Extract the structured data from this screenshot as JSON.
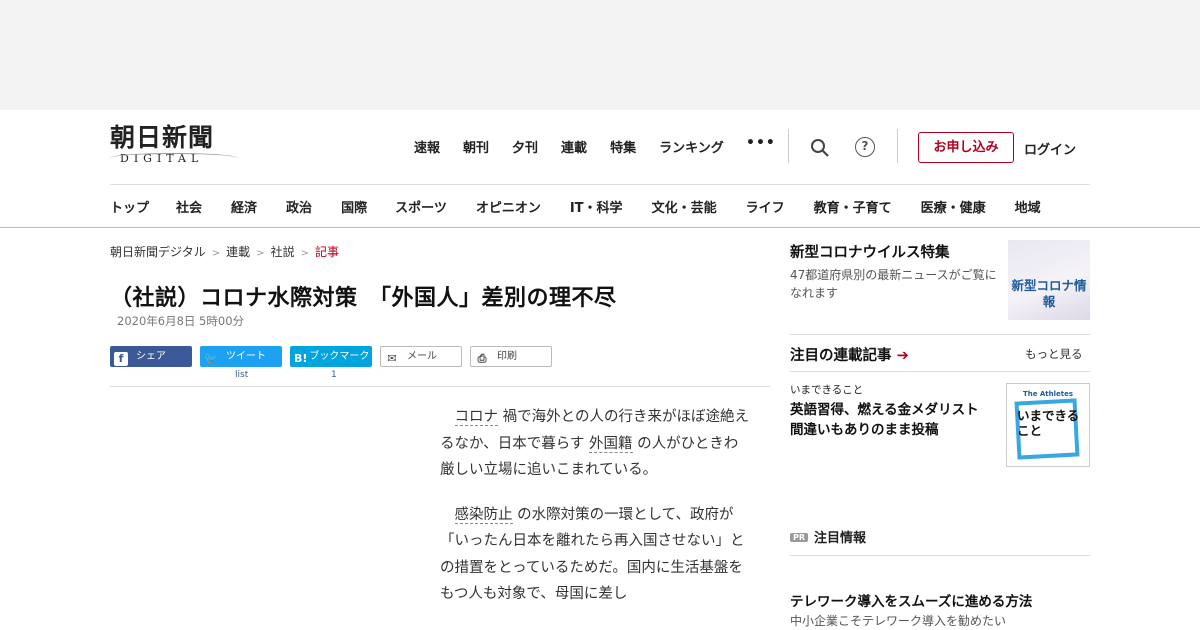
{
  "logo": {
    "main": "朝日新聞",
    "sub": "DIGITAL"
  },
  "top_nav": [
    "速報",
    "朝刊",
    "夕刊",
    "連載",
    "特集",
    "ランキング"
  ],
  "header_actions": {
    "more": "•••",
    "help": "?",
    "apply": "お申し込み",
    "login": "ログイン"
  },
  "category_nav": [
    {
      "label": "トップ"
    },
    {
      "label": "社会"
    },
    {
      "label": "経済"
    },
    {
      "label": "政治"
    },
    {
      "label": "国際"
    },
    {
      "label": "スポーツ"
    },
    {
      "label": "オピニオン"
    },
    {
      "label": "IT・科学"
    },
    {
      "label": "文化・芸能"
    },
    {
      "label": "ライフ"
    },
    {
      "label": "教育・子育て"
    },
    {
      "label": "医療・健康"
    },
    {
      "label": "地域"
    }
  ],
  "breadcrumb": {
    "items": [
      "朝日新聞デジタル",
      "連載",
      "社説"
    ],
    "current": "記事",
    "sep": ">"
  },
  "article": {
    "title": "（社説）コロナ水際対策　「外国人」差別の理不尽",
    "date": "2020年6月8日 5時00分",
    "share": {
      "facebook": "シェア",
      "twitter": "ツイート",
      "hatena_mark": "B!",
      "hatena": "ブックマーク",
      "mail": "メール",
      "print": "印刷",
      "twitter_count": "list",
      "hatena_count": "1"
    },
    "p1": {
      "kw1": "コロナ",
      "t1": "禍で海外との人の行き来がほぼ途絶えるなか、日本で暮らす",
      "kw2": "外国籍",
      "t2": "の人がひときわ厳しい立場に追いこまれている。"
    },
    "p2": {
      "kw1": "感染防止",
      "t1": "の水際対策の一環として、政府が「いったん日本を離れたら再入国させない」との措置をとっているためだ。国内に生活基盤をもつ人も対象で、母国に差し"
    }
  },
  "sidebar": {
    "corona": {
      "title": "新型コロナウイルス特集",
      "desc": "47都道府県別の最新ニュースがご覧になれます",
      "image_text": "新型コロナ情報"
    },
    "series": {
      "title": "注目の連載記事",
      "arrow": "➔",
      "more": "もっと見る",
      "item_tag": "いまできること",
      "item_title": "英語習得、燃える金メダリスト　間違いもありのまま投稿",
      "image_top": "The Athletes",
      "image_text": "いまできること"
    },
    "pr": {
      "badge": "PR",
      "title": "注目情報"
    },
    "promo": {
      "title": "テレワーク導入をスムーズに進める方法",
      "desc": "中小企業こそテレワーク導入を勧めたい"
    }
  },
  "colors": {
    "accent": "#b4001e",
    "facebook": "#3b5998",
    "twitter": "#1da1f2",
    "hatena": "#00a4de"
  }
}
